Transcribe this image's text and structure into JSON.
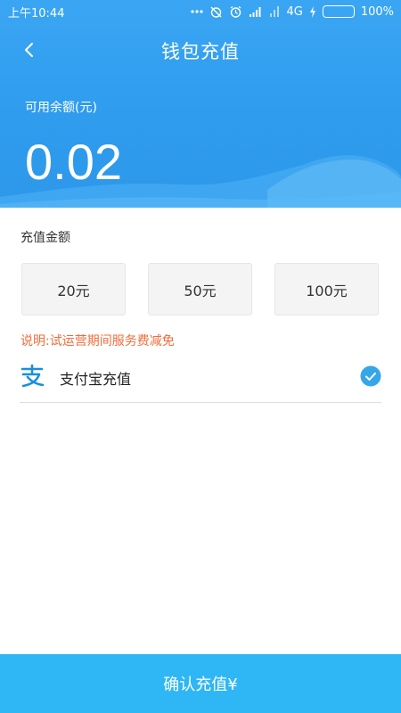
{
  "status_bar": {
    "time": "上午10:44",
    "network": "4G",
    "battery": "100%",
    "icons": [
      "dots-icon",
      "alarm-off-icon",
      "alarm-icon",
      "hd-signal-icon",
      "signal-icon",
      "charging-icon",
      "battery-icon"
    ],
    "battery_level": 1.0
  },
  "header": {
    "title": "钱包充值",
    "back_icon": "chevron-left-icon"
  },
  "balance": {
    "label": "可用余额(元)",
    "value": "0.02"
  },
  "recharge": {
    "title": "充值金额",
    "amounts": [
      "20元",
      "50元",
      "100元"
    ],
    "note": "说明:试运营期间服务费减免"
  },
  "payment": {
    "method_label": "支付宝充值",
    "icon": "alipay-icon",
    "selected": true
  },
  "confirm_label": "确认充值¥",
  "colors": {
    "header_blue": "#3aa6f3",
    "confirm_blue": "#2fb7f5",
    "note_orange": "#f06c3b",
    "check_blue": "#35a6e8"
  }
}
